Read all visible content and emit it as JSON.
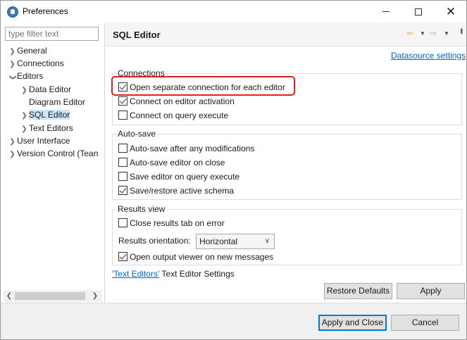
{
  "window": {
    "title": "Preferences",
    "controls": {
      "minimize": "—",
      "maximize": "☐",
      "close": "✕"
    }
  },
  "sidebar": {
    "filter_placeholder": "type filter text",
    "items": [
      {
        "label": "General",
        "expander": ">"
      },
      {
        "label": "Connections",
        "expander": ">"
      },
      {
        "label": "Editors",
        "expander": "v"
      },
      {
        "label": "Data Editor",
        "expander": ">"
      },
      {
        "label": "Diagram Editor",
        "expander": ""
      },
      {
        "label": "SQL Editor",
        "expander": ">",
        "selected": true
      },
      {
        "label": "Text Editors",
        "expander": ">"
      },
      {
        "label": "User Interface",
        "expander": ">"
      },
      {
        "label": "Version Control (Tean",
        "expander": ">"
      }
    ],
    "scroll_left": "<",
    "scroll_right": ">"
  },
  "page": {
    "title": "SQL Editor",
    "datasource_link": "Datasource settings",
    "nav_icons": [
      "back-arrow-icon",
      "forward-arrow-icon",
      "view-menu-icon"
    ],
    "connections": {
      "label": "Connections",
      "options": [
        {
          "label": "Open separate connection for each editor",
          "checked": true
        },
        {
          "label": "Connect on editor activation",
          "checked": true
        },
        {
          "label": "Connect on query execute",
          "checked": false
        }
      ]
    },
    "autosave": {
      "label": "Auto-save",
      "options": [
        {
          "label": "Auto-save after any modifications",
          "checked": false
        },
        {
          "label": "Auto-save editor on close",
          "checked": false
        },
        {
          "label": "Save editor on query execute",
          "checked": false
        },
        {
          "label": "Save/restore active schema",
          "checked": true
        }
      ]
    },
    "results": {
      "label": "Results view",
      "close_tab": {
        "label": "Close results tab on error",
        "checked": false
      },
      "orientation_label": "Results orientation:",
      "orientation_value": "Horizontal",
      "output_viewer": {
        "label": "Open output viewer on new messages",
        "checked": true
      }
    },
    "text_editors_link": "'Text Editors'",
    "text_editors_suffix": " Text Editor Settings",
    "restore_defaults": "Restore Defaults",
    "apply": "Apply"
  },
  "footer": {
    "apply_close": "Apply and Close",
    "cancel": "Cancel"
  },
  "colors": {
    "accent": "#0078d7",
    "link": "#0066cc",
    "highlight": "#e02020",
    "selection": "#cce4f7"
  }
}
